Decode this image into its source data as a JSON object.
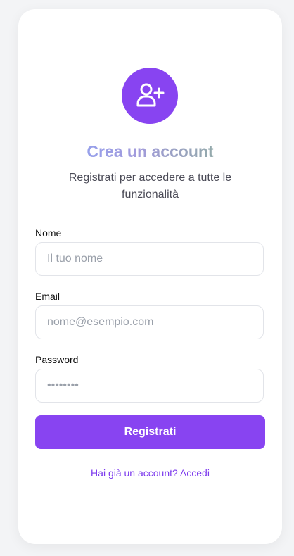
{
  "header": {
    "title": "Crea un account",
    "subtitle": "Registrati per accedere a tutte le funzionalità"
  },
  "avatar_icon": "user-plus-icon",
  "form": {
    "name": {
      "label": "Nome",
      "placeholder": "Il tuo nome",
      "value": ""
    },
    "email": {
      "label": "Email",
      "placeholder": "nome@esempio.com",
      "value": ""
    },
    "password": {
      "label": "Password",
      "placeholder": "••••••••",
      "value": ""
    }
  },
  "submit_label": "Registrati",
  "login_link": "Hai già un account? Accedi",
  "colors": {
    "accent": "#8844f1",
    "link": "#7c3aed",
    "background": "#f3f4f6",
    "title_gradient": [
      "#86a6ff",
      "#a29bdc",
      "#86b67f"
    ]
  }
}
